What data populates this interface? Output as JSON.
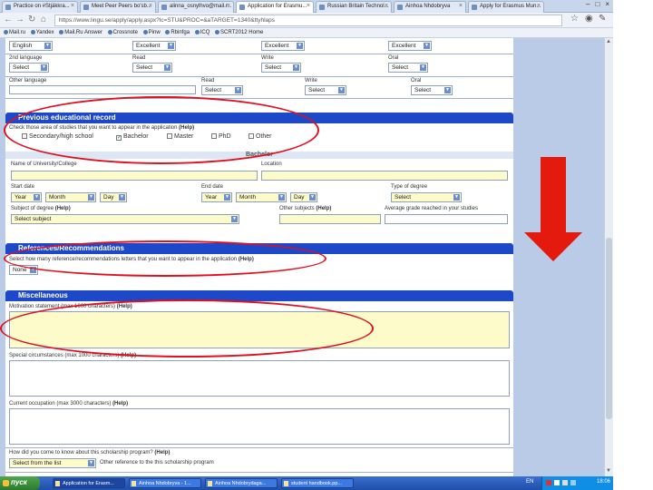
{
  "browser": {
    "tabs": [
      {
        "label": "Practice on #Stjäkkra...",
        "active": false
      },
      {
        "label": "Meet Peer Peers bo'sb...",
        "active": false
      },
      {
        "label": "alinna_osnylhvo@mail.r...",
        "active": false
      },
      {
        "label": "Application for Erasmu...",
        "active": true
      },
      {
        "label": "Russian Britain Technol...",
        "active": false
      },
      {
        "label": "Ainhoa Nhdobryva",
        "active": false
      },
      {
        "label": "Apply for Erasmus Mun...",
        "active": false
      }
    ],
    "url": "https://www.lingu.se/apply/apply.aspx?lc=STU&PROC=&aTARGET=1340&ttyhlaps",
    "bookmarks": [
      "Mail.ru",
      "Yandex",
      "Mail.Ru Answer",
      "Crossnote",
      "Pinw",
      "Rbinfga",
      "ICQ",
      "SCRT2012 Home"
    ]
  },
  "languages": {
    "row1": {
      "sel1": "English",
      "sel2": "Excellent",
      "sel3": "Excellent",
      "sel4": "Excellent"
    },
    "row2": {
      "label1": "2nd language",
      "label2": "Read",
      "label3": "Write",
      "label4": "Oral",
      "sel1": "Select",
      "sel2": "Select",
      "sel3": "Select",
      "sel4": "Select"
    },
    "row3": {
      "label1": "Other language",
      "label2": "Read",
      "label3": "Write",
      "label4": "Oral",
      "sel2": "Select",
      "sel3": "Select",
      "sel4": "Select"
    }
  },
  "education": {
    "title": "Previous educational record",
    "instruction": "Check those area of studies that you want to appear in the application",
    "help": "(Help)",
    "options": [
      {
        "label": "Secondary/high school",
        "checked": false
      },
      {
        "label": "Bachelor",
        "checked": true
      },
      {
        "label": "Master",
        "checked": false
      },
      {
        "label": "PhD",
        "checked": false
      },
      {
        "label": "Other",
        "checked": false
      }
    ],
    "subsection": "Bachelor",
    "name_label": "Name of University/College",
    "location_label": "Location",
    "start_label": "Start date",
    "end_label": "End date",
    "degree_label": "Type of degree",
    "start": {
      "year": "Year",
      "month": "Month",
      "day": "Day"
    },
    "end": {
      "year": "Year",
      "month": "Month",
      "day": "Day"
    },
    "degree_select": "Select",
    "subject_label": "Subject of degree",
    "subject_help": "(Help)",
    "subject_select": "Select subject",
    "other_subjects_label": "Other subjects",
    "other_subjects_help": "(Help)",
    "avg_grade_label": "Average grade reached in your studies"
  },
  "references": {
    "title": "References/Recommendations",
    "instruction": "Select how many reference/recommendations letters that you want to appear in the application",
    "help": "(Help)",
    "select": "None"
  },
  "misc": {
    "title": "Miscellaneous",
    "motivation_label": "Motivation statement (max 1000 characters)",
    "motivation_help": "(Help)",
    "special_label": "Special circumstances (max 1000 characters)",
    "special_help": "(Help)",
    "current_label": "Current occupation (max 3000 characters)",
    "current_help": "(Help)",
    "howknow_label": "How did you come to know about this scholarship program?",
    "howknow_help": "(Help)",
    "howknow_select": "Select from the list",
    "other_ref_label": "Other reference to the this scholarship program"
  },
  "taskbar": {
    "start": "пуск",
    "tasks": [
      {
        "label": "Application for Erasm...",
        "active": true
      },
      {
        "label": "Ainhoa Nhdobryva - 1...",
        "active": false
      },
      {
        "label": "Ainhoa Nhdobrydaga...",
        "active": false
      },
      {
        "label": "student handbook.pp...",
        "active": false
      }
    ],
    "lang": "EN",
    "clock": "18:06"
  },
  "colors": {
    "section_header": "#1d48c8",
    "annotation": "#e01020",
    "arrow": "#e51a0e",
    "highlight_input": "#fdfbc9"
  }
}
